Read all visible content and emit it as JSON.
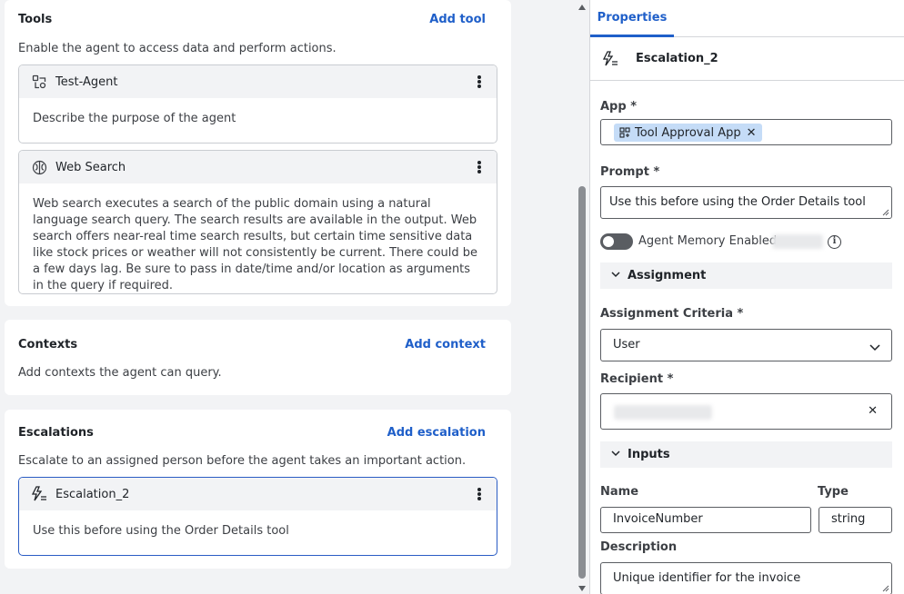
{
  "tools": {
    "title": "Tools",
    "add_label": "Add tool",
    "description": "Enable the agent to access data and perform actions.",
    "items": [
      {
        "name": "Test-Agent",
        "icon": "agent-icon",
        "description": "Describe the purpose of the agent"
      },
      {
        "name": "Web Search",
        "icon": "brain-icon",
        "description": "Web search executes a search of the public domain using a natural language search query. The search results are available in the output. Web search offers near-real time search results, but certain time sensitive data like stock prices or weather will not consistently be current. There could be a few days lag. Be sure to pass in date/time and/or location as arguments in the query if required."
      }
    ]
  },
  "contexts": {
    "title": "Contexts",
    "add_label": "Add context",
    "description": "Add contexts the agent can query."
  },
  "escalations": {
    "title": "Escalations",
    "add_label": "Add escalation",
    "description": "Escalate to an assigned person before the agent takes an important action.",
    "items": [
      {
        "name": "Escalation_2",
        "icon": "escalation-icon",
        "description": "Use this before using the Order Details tool"
      }
    ]
  },
  "properties": {
    "tab_label": "Properties",
    "title": "Escalation_2",
    "app_label": "App *",
    "app_chip": "Tool Approval App",
    "prompt_label": "Prompt *",
    "prompt_value": "Use this before using the Order Details tool",
    "memory_label": "Agent Memory Enabled",
    "memory_enabled": false,
    "assignment_section": "Assignment",
    "criteria_label": "Assignment Criteria *",
    "criteria_value": "User",
    "recipient_label": "Recipient *",
    "inputs_section": "Inputs",
    "name_col": "Name",
    "type_col": "Type",
    "input_name": "InvoiceNumber",
    "input_type": "string",
    "description_label": "Description",
    "description_value": "Unique identifier for the invoice"
  },
  "colors": {
    "accent": "#1f5fc9",
    "chip": "#c5dcf7",
    "selected_border": "#2a5cc4"
  }
}
